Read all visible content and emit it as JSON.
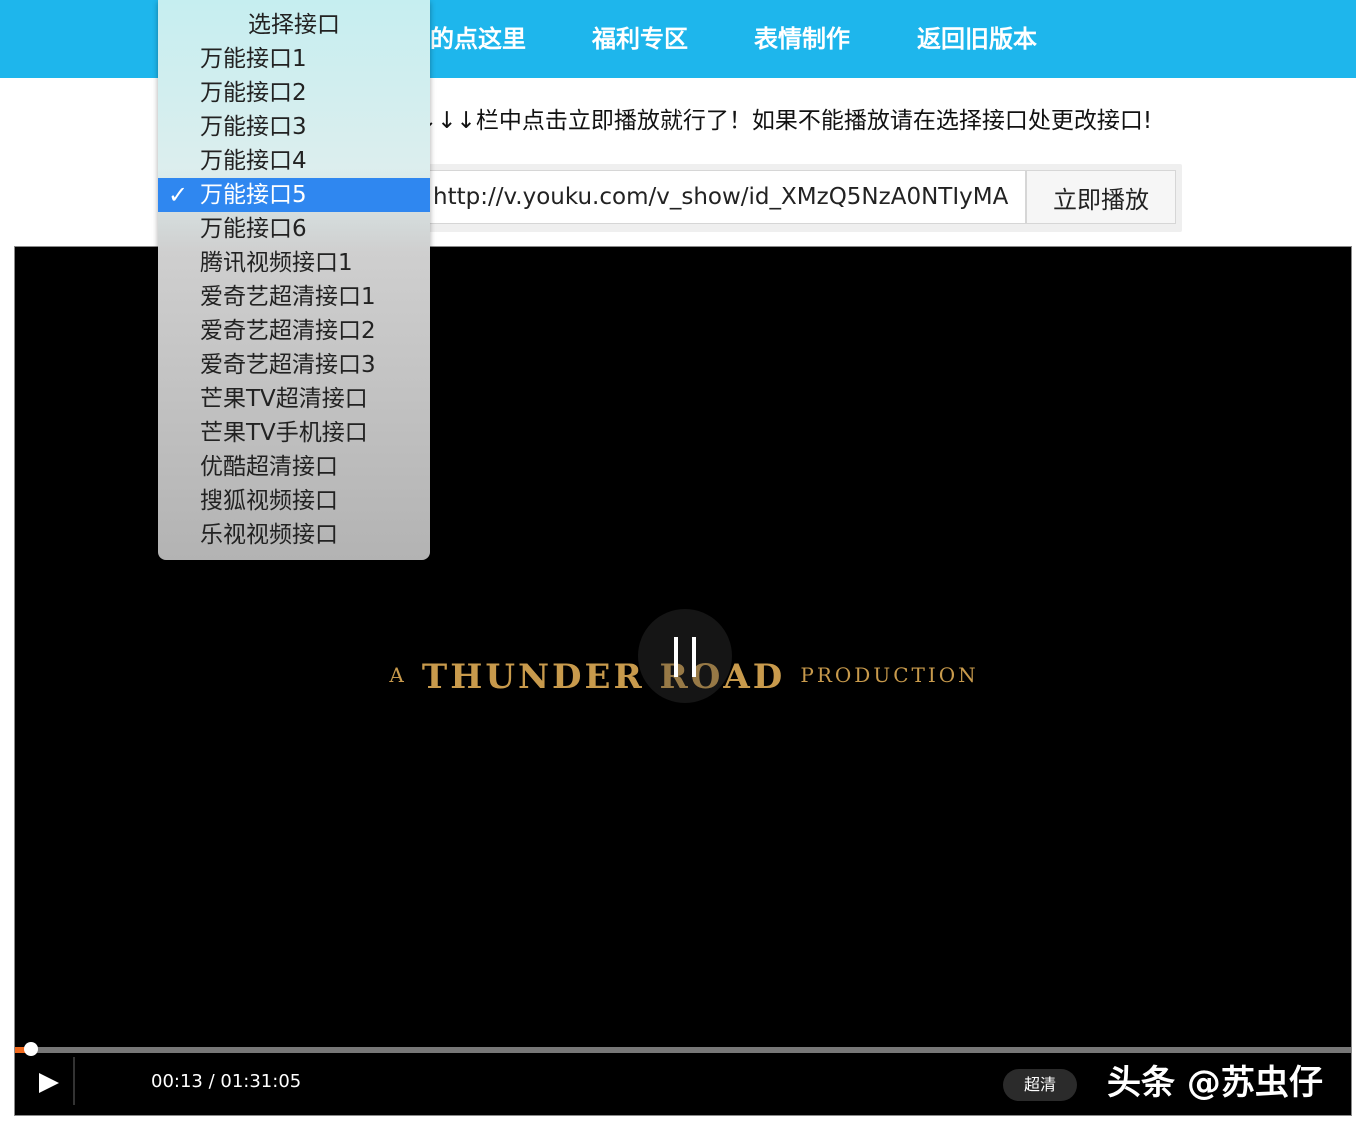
{
  "nav": {
    "items": [
      {
        "label": "的点这里"
      },
      {
        "label": "福利专区"
      },
      {
        "label": "表情制作"
      },
      {
        "label": "返回旧版本"
      }
    ]
  },
  "instruction": "↓↓↓栏中点击立即播放就行了！如果不能播放请在选择接口处更改接口!",
  "url_bar": {
    "value": "http://v.youku.com/v_show/id_XMzQ5NzA0NTIyMA",
    "button_label": "立即播放"
  },
  "dropdown": {
    "header": "选择接口",
    "selected_index": 4,
    "options": [
      "万能接口1",
      "万能接口2",
      "万能接口3",
      "万能接口4",
      "万能接口5",
      "万能接口6",
      "腾讯视频接口1",
      "爱奇艺超清接口1",
      "爱奇艺超清接口2",
      "爱奇艺超清接口3",
      "芒果TV超清接口",
      "芒果TV手机接口",
      "优酷超清接口",
      "搜狐视频接口",
      "乐视视频接口"
    ]
  },
  "player": {
    "frame_text": {
      "prefix": "A",
      "main": "THUNDER ROAD",
      "suffix": "PRODUCTION"
    },
    "current_time": "00:13",
    "separator": " / ",
    "duration": "01:31:05",
    "progress_fraction": 0.0024,
    "quality_label": "超清",
    "icons": {
      "play": "play-icon",
      "pause": "pause-icon"
    }
  },
  "watermark": "头条 @苏虫仔",
  "colors": {
    "nav_bg": "#1eb6ec",
    "selected_bg": "#2f87f0",
    "progress": "#f06a1e",
    "title_gold": "#c89a4c"
  }
}
